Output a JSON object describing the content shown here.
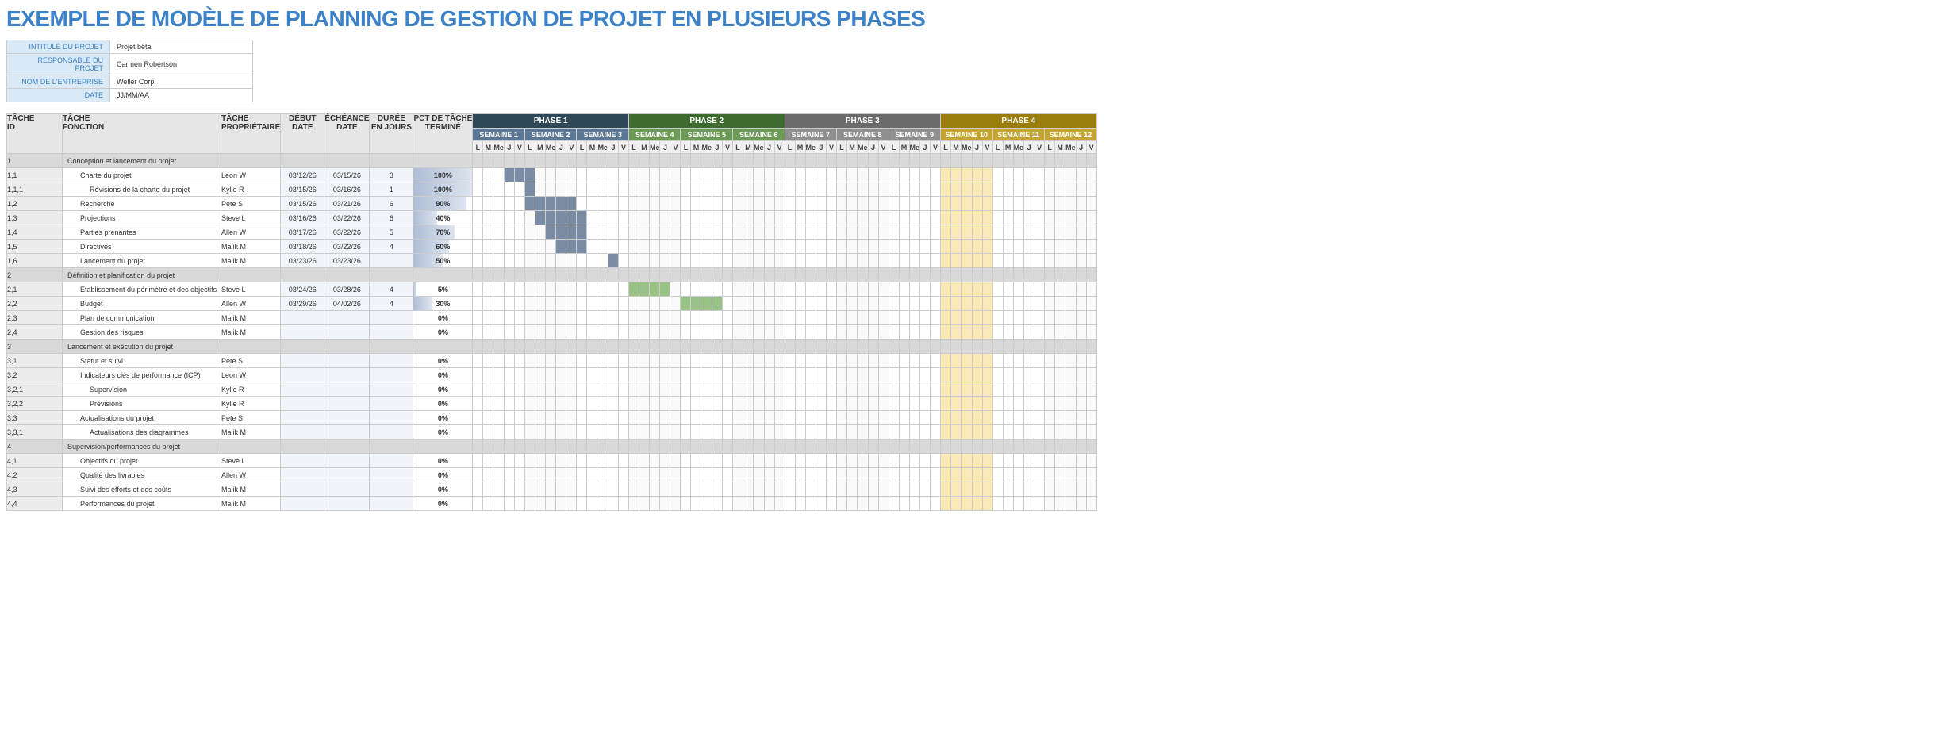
{
  "title": "EXEMPLE DE MODÈLE DE PLANNING DE GESTION DE PROJET EN PLUSIEURS PHASES",
  "meta": {
    "labels": {
      "project_title": "INTITULÉ DU PROJET",
      "manager": "RESPONSABLE DU PROJET",
      "company": "NOM DE L'ENTREPRISE",
      "date": "DATE"
    },
    "values": {
      "project_title": "Projet bêta",
      "manager": "Carmen Robertson",
      "company": "Weller Corp.",
      "date": "JJ/MM/AA"
    }
  },
  "headers": {
    "task_id_l1": "TÂCHE",
    "task_id_l2": "ID",
    "task_fn_l1": "TÂCHE",
    "task_fn_l2": "FONCTION",
    "owner_l1": "TÂCHE",
    "owner_l2": "PROPRIÉTAIRE",
    "start_l1": "DÉBUT",
    "start_l2": "DATE",
    "due_l1": "ÉCHÉANCE",
    "due_l2": "DATE",
    "dur_l1": "DURÉE",
    "dur_l2": "EN JOURS",
    "pct_l1": "PCT DE TÂCHE",
    "pct_l2": "TERMINÉ"
  },
  "phases": [
    "PHASE 1",
    "PHASE 2",
    "PHASE 3",
    "PHASE 4"
  ],
  "weeks": [
    "SEMAINE 1",
    "SEMAINE 2",
    "SEMAINE 3",
    "SEMAINE 4",
    "SEMAINE 5",
    "SEMAINE 6",
    "SEMAINE 7",
    "SEMAINE 8",
    "SEMAINE 9",
    "SEMAINE 10",
    "SEMAINE 11",
    "SEMAINE 12"
  ],
  "days": [
    "L",
    "M",
    "Me",
    "J",
    "V"
  ],
  "rows": [
    {
      "id": "1",
      "fn": "Conception et lancement du projet",
      "section": true
    },
    {
      "id": "1,1",
      "fn": "Charte du projet",
      "indent": 1,
      "own": "Leon W",
      "start": "03/12/26",
      "due": "03/15/26",
      "dur": "3",
      "pct": "100%",
      "pctv": 100,
      "bar": {
        "phase": 1,
        "from": 4,
        "to": 6
      }
    },
    {
      "id": "1,1,1",
      "fn": "Révisions de la charte du projet",
      "indent": 2,
      "own": "Kylie R",
      "start": "03/15/26",
      "due": "03/16/26",
      "dur": "1",
      "pct": "100%",
      "pctv": 100,
      "bar": {
        "phase": 1,
        "from": 6,
        "to": 6
      }
    },
    {
      "id": "1,2",
      "fn": "Recherche",
      "indent": 1,
      "own": "Pete S",
      "start": "03/15/26",
      "due": "03/21/26",
      "dur": "6",
      "pct": "90%",
      "pctv": 90,
      "bar": {
        "phase": 1,
        "from": 6,
        "to": 10
      }
    },
    {
      "id": "1,3",
      "fn": "Projections",
      "indent": 1,
      "own": "Steve L",
      "start": "03/16/26",
      "due": "03/22/26",
      "dur": "6",
      "pct": "40%",
      "pctv": 40,
      "bar": {
        "phase": 1,
        "from": 7,
        "to": 11
      }
    },
    {
      "id": "1,4",
      "fn": "Parties prenantes",
      "indent": 1,
      "own": "Allen W",
      "start": "03/17/26",
      "due": "03/22/26",
      "dur": "5",
      "pct": "70%",
      "pctv": 70,
      "bar": {
        "phase": 1,
        "from": 8,
        "to": 11
      }
    },
    {
      "id": "1,5",
      "fn": "Directives",
      "indent": 1,
      "own": "Malik M",
      "start": "03/18/26",
      "due": "03/22/26",
      "dur": "4",
      "pct": "60%",
      "pctv": 60,
      "bar": {
        "phase": 1,
        "from": 9,
        "to": 11
      }
    },
    {
      "id": "1,6",
      "fn": "Lancement du projet",
      "indent": 1,
      "own": "Malik M",
      "start": "03/23/26",
      "due": "03/23/26",
      "dur": "",
      "pct": "50%",
      "pctv": 50,
      "bar": {
        "phase": 1,
        "from": 14,
        "to": 14
      }
    },
    {
      "id": "2",
      "fn": "Définition et planification du projet",
      "section": true
    },
    {
      "id": "2,1",
      "fn": "Établissement du périmètre et des objectifs",
      "indent": 1,
      "own": "Steve L",
      "start": "03/24/26",
      "due": "03/28/26",
      "dur": "4",
      "pct": "5%",
      "pctv": 5,
      "bar": {
        "phase": 2,
        "from": 1,
        "to": 4
      }
    },
    {
      "id": "2,2",
      "fn": "Budget",
      "indent": 1,
      "own": "Allen W",
      "start": "03/29/26",
      "due": "04/02/26",
      "dur": "4",
      "pct": "30%",
      "pctv": 30,
      "bar": {
        "phase": 2,
        "from": 6,
        "to": 9
      }
    },
    {
      "id": "2,3",
      "fn": "Plan de communication",
      "indent": 1,
      "own": "Malik M",
      "start": "",
      "due": "",
      "dur": "",
      "pct": "0%",
      "pctv": 0
    },
    {
      "id": "2,4",
      "fn": "Gestion des risques",
      "indent": 1,
      "own": "Malik M",
      "start": "",
      "due": "",
      "dur": "",
      "pct": "0%",
      "pctv": 0
    },
    {
      "id": "3",
      "fn": "Lancement et exécution du projet",
      "section": true
    },
    {
      "id": "3,1",
      "fn": "Statut et suivi",
      "indent": 1,
      "own": "Pete S",
      "start": "",
      "due": "",
      "dur": "",
      "pct": "0%",
      "pctv": 0
    },
    {
      "id": "3,2",
      "fn": "Indicateurs clés de performance (ICP)",
      "indent": 1,
      "own": "Leon W",
      "start": "",
      "due": "",
      "dur": "",
      "pct": "0%",
      "pctv": 0
    },
    {
      "id": "3,2,1",
      "fn": "Supervision",
      "indent": 2,
      "own": "Kylie R",
      "start": "",
      "due": "",
      "dur": "",
      "pct": "0%",
      "pctv": 0
    },
    {
      "id": "3,2,2",
      "fn": "Prévisions",
      "indent": 2,
      "own": "Kylie R",
      "start": "",
      "due": "",
      "dur": "",
      "pct": "0%",
      "pctv": 0
    },
    {
      "id": "3,3",
      "fn": "Actualisations du projet",
      "indent": 1,
      "own": "Pete S",
      "start": "",
      "due": "",
      "dur": "",
      "pct": "0%",
      "pctv": 0
    },
    {
      "id": "3,3,1",
      "fn": "Actualisations des diagrammes",
      "indent": 2,
      "own": "Malik M",
      "start": "",
      "due": "",
      "dur": "",
      "pct": "0%",
      "pctv": 0
    },
    {
      "id": "4",
      "fn": "Supervision/performances du projet",
      "section": true
    },
    {
      "id": "4,1",
      "fn": "Objectifs du projet",
      "indent": 1,
      "own": "Steve L",
      "start": "",
      "due": "",
      "dur": "",
      "pct": "0%",
      "pctv": 0
    },
    {
      "id": "4,2",
      "fn": "Qualité des livrables",
      "indent": 1,
      "own": "Allen W",
      "start": "",
      "due": "",
      "dur": "",
      "pct": "0%",
      "pctv": 0
    },
    {
      "id": "4,3",
      "fn": "Suivi des efforts et des coûts",
      "indent": 1,
      "own": "Malik M",
      "start": "",
      "due": "",
      "dur": "",
      "pct": "0%",
      "pctv": 0
    },
    {
      "id": "4,4",
      "fn": "Performances du projet",
      "indent": 1,
      "own": "Malik M",
      "start": "",
      "due": "",
      "dur": "",
      "pct": "0%",
      "pctv": 0
    }
  ],
  "chart_data": {
    "type": "bar",
    "title": "Gantt — PCT DE TÂCHE TERMINÉ",
    "categories": [
      "1,1",
      "1,1,1",
      "1,2",
      "1,3",
      "1,4",
      "1,5",
      "1,6",
      "2,1",
      "2,2",
      "2,3",
      "2,4",
      "3,1",
      "3,2",
      "3,2,1",
      "3,2,2",
      "3,3",
      "3,3,1",
      "4,1",
      "4,2",
      "4,3",
      "4,4"
    ],
    "values": [
      100,
      100,
      90,
      40,
      70,
      60,
      50,
      5,
      30,
      0,
      0,
      0,
      0,
      0,
      0,
      0,
      0,
      0,
      0,
      0,
      0
    ],
    "xlabel": "Tâche ID",
    "ylabel": "% terminé",
    "ylim": [
      0,
      100
    ]
  }
}
